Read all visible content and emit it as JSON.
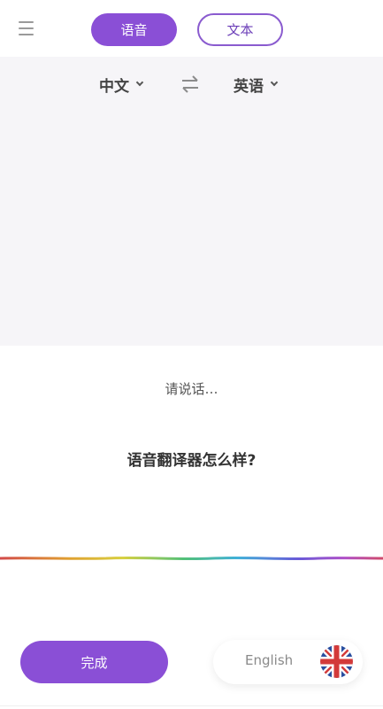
{
  "header": {
    "menu_icon": "hamburger-menu-icon",
    "mode_tabs": [
      {
        "label": "语音",
        "active": true
      },
      {
        "label": "文本",
        "active": false
      }
    ]
  },
  "languages": {
    "source": "中文",
    "target": "英语",
    "swap_icon": "swap-arrows-icon"
  },
  "speech": {
    "prompt": "请说话…",
    "recognized_text": "语音翻译器怎么样?"
  },
  "footer": {
    "done_label": "完成",
    "language_label": "English",
    "flag_icon": "uk-flag-icon"
  },
  "colors": {
    "accent": "#8a4fd6",
    "panel_bg": "#f6f5f8"
  }
}
